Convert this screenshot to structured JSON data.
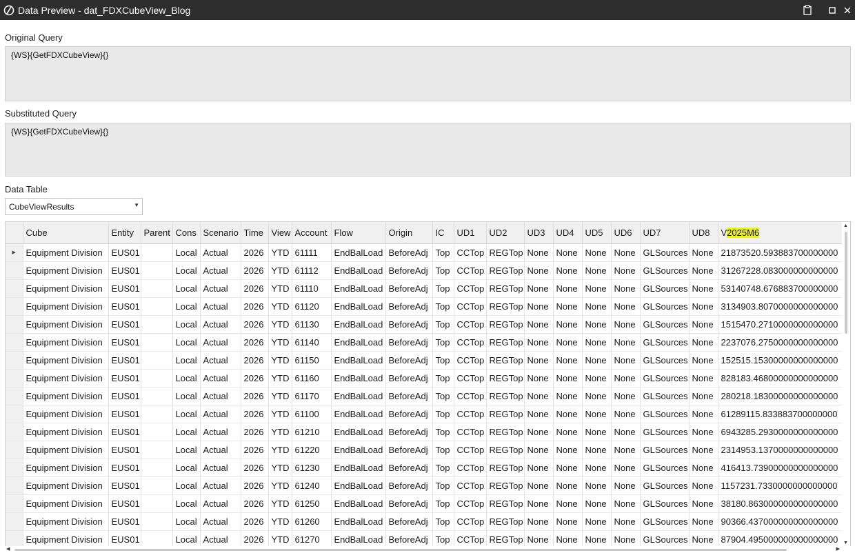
{
  "window": {
    "title": "Data Preview - dat_FDXCubeView_Blog"
  },
  "original_query": {
    "label": "Original Query",
    "value": "{WS}{GetFDXCubeView}{}"
  },
  "substituted_query": {
    "label": "Substituted Query",
    "value": "{WS}{GetFDXCubeView}{}"
  },
  "data_table": {
    "label": "Data Table",
    "selected": "CubeViewResults"
  },
  "grid": {
    "columns": [
      "Cube",
      "Entity",
      "Parent",
      "Cons",
      "Scenario",
      "Time",
      "View",
      "Account",
      "Flow",
      "Origin",
      "IC",
      "UD1",
      "UD2",
      "UD3",
      "UD4",
      "UD5",
      "UD6",
      "UD7",
      "UD8"
    ],
    "last_column": {
      "prefix": "V",
      "highlight": "2025M6"
    },
    "rows": [
      [
        "Equipment Division",
        "EUS01",
        "",
        "Local",
        "Actual",
        "2026",
        "YTD",
        "61111",
        "EndBalLoad",
        "BeforeAdj",
        "Top",
        "CCTop",
        "REGTop",
        "None",
        "None",
        "None",
        "None",
        "GLSources",
        "None",
        "21873520.593883700000000"
      ],
      [
        "Equipment Division",
        "EUS01",
        "",
        "Local",
        "Actual",
        "2026",
        "YTD",
        "61112",
        "EndBalLoad",
        "BeforeAdj",
        "Top",
        "CCTop",
        "REGTop",
        "None",
        "None",
        "None",
        "None",
        "GLSources",
        "None",
        "31267228.083000000000000"
      ],
      [
        "Equipment Division",
        "EUS01",
        "",
        "Local",
        "Actual",
        "2026",
        "YTD",
        "61110",
        "EndBalLoad",
        "BeforeAdj",
        "Top",
        "CCTop",
        "REGTop",
        "None",
        "None",
        "None",
        "None",
        "GLSources",
        "None",
        "53140748.676883700000000"
      ],
      [
        "Equipment Division",
        "EUS01",
        "",
        "Local",
        "Actual",
        "2026",
        "YTD",
        "61120",
        "EndBalLoad",
        "BeforeAdj",
        "Top",
        "CCTop",
        "REGTop",
        "None",
        "None",
        "None",
        "None",
        "GLSources",
        "None",
        "3134903.8070000000000000"
      ],
      [
        "Equipment Division",
        "EUS01",
        "",
        "Local",
        "Actual",
        "2026",
        "YTD",
        "61130",
        "EndBalLoad",
        "BeforeAdj",
        "Top",
        "CCTop",
        "REGTop",
        "None",
        "None",
        "None",
        "None",
        "GLSources",
        "None",
        "1515470.2710000000000000"
      ],
      [
        "Equipment Division",
        "EUS01",
        "",
        "Local",
        "Actual",
        "2026",
        "YTD",
        "61140",
        "EndBalLoad",
        "BeforeAdj",
        "Top",
        "CCTop",
        "REGTop",
        "None",
        "None",
        "None",
        "None",
        "GLSources",
        "None",
        "2237076.2750000000000000"
      ],
      [
        "Equipment Division",
        "EUS01",
        "",
        "Local",
        "Actual",
        "2026",
        "YTD",
        "61150",
        "EndBalLoad",
        "BeforeAdj",
        "Top",
        "CCTop",
        "REGTop",
        "None",
        "None",
        "None",
        "None",
        "GLSources",
        "None",
        "152515.15300000000000000"
      ],
      [
        "Equipment Division",
        "EUS01",
        "",
        "Local",
        "Actual",
        "2026",
        "YTD",
        "61160",
        "EndBalLoad",
        "BeforeAdj",
        "Top",
        "CCTop",
        "REGTop",
        "None",
        "None",
        "None",
        "None",
        "GLSources",
        "None",
        "828183.46800000000000000"
      ],
      [
        "Equipment Division",
        "EUS01",
        "",
        "Local",
        "Actual",
        "2026",
        "YTD",
        "61170",
        "EndBalLoad",
        "BeforeAdj",
        "Top",
        "CCTop",
        "REGTop",
        "None",
        "None",
        "None",
        "None",
        "GLSources",
        "None",
        "280218.18300000000000000"
      ],
      [
        "Equipment Division",
        "EUS01",
        "",
        "Local",
        "Actual",
        "2026",
        "YTD",
        "61100",
        "EndBalLoad",
        "BeforeAdj",
        "Top",
        "CCTop",
        "REGTop",
        "None",
        "None",
        "None",
        "None",
        "GLSources",
        "None",
        "61289115.833883700000000"
      ],
      [
        "Equipment Division",
        "EUS01",
        "",
        "Local",
        "Actual",
        "2026",
        "YTD",
        "61210",
        "EndBalLoad",
        "BeforeAdj",
        "Top",
        "CCTop",
        "REGTop",
        "None",
        "None",
        "None",
        "None",
        "GLSources",
        "None",
        "6943285.2930000000000000"
      ],
      [
        "Equipment Division",
        "EUS01",
        "",
        "Local",
        "Actual",
        "2026",
        "YTD",
        "61220",
        "EndBalLoad",
        "BeforeAdj",
        "Top",
        "CCTop",
        "REGTop",
        "None",
        "None",
        "None",
        "None",
        "GLSources",
        "None",
        "2314953.1370000000000000"
      ],
      [
        "Equipment Division",
        "EUS01",
        "",
        "Local",
        "Actual",
        "2026",
        "YTD",
        "61230",
        "EndBalLoad",
        "BeforeAdj",
        "Top",
        "CCTop",
        "REGTop",
        "None",
        "None",
        "None",
        "None",
        "GLSources",
        "None",
        "416413.73900000000000000"
      ],
      [
        "Equipment Division",
        "EUS01",
        "",
        "Local",
        "Actual",
        "2026",
        "YTD",
        "61240",
        "EndBalLoad",
        "BeforeAdj",
        "Top",
        "CCTop",
        "REGTop",
        "None",
        "None",
        "None",
        "None",
        "GLSources",
        "None",
        "1157231.7330000000000000"
      ],
      [
        "Equipment Division",
        "EUS01",
        "",
        "Local",
        "Actual",
        "2026",
        "YTD",
        "61250",
        "EndBalLoad",
        "BeforeAdj",
        "Top",
        "CCTop",
        "REGTop",
        "None",
        "None",
        "None",
        "None",
        "GLSources",
        "None",
        "38180.863000000000000000"
      ],
      [
        "Equipment Division",
        "EUS01",
        "",
        "Local",
        "Actual",
        "2026",
        "YTD",
        "61260",
        "EndBalLoad",
        "BeforeAdj",
        "Top",
        "CCTop",
        "REGTop",
        "None",
        "None",
        "None",
        "None",
        "GLSources",
        "None",
        "90366.437000000000000000"
      ],
      [
        "Equipment Division",
        "EUS01",
        "",
        "Local",
        "Actual",
        "2026",
        "YTD",
        "61270",
        "EndBalLoad",
        "BeforeAdj",
        "Top",
        "CCTop",
        "REGTop",
        "None",
        "None",
        "None",
        "None",
        "GLSources",
        "None",
        "87904.495000000000000000"
      ]
    ],
    "current_row_index": 0
  },
  "icons": {
    "app_logo": "app-logo-icon",
    "clipboard": "clipboard-icon",
    "maximize": "maximize-icon",
    "close": "close-icon",
    "dropdown": "dropdown-arrow-icon",
    "row_pointer": "row-pointer-icon"
  },
  "colors": {
    "titlebar": "#2d2d2d",
    "query_bg": "#e9e9e9",
    "grid_header": "#f0f0f0",
    "highlight": "#ecef3a"
  }
}
